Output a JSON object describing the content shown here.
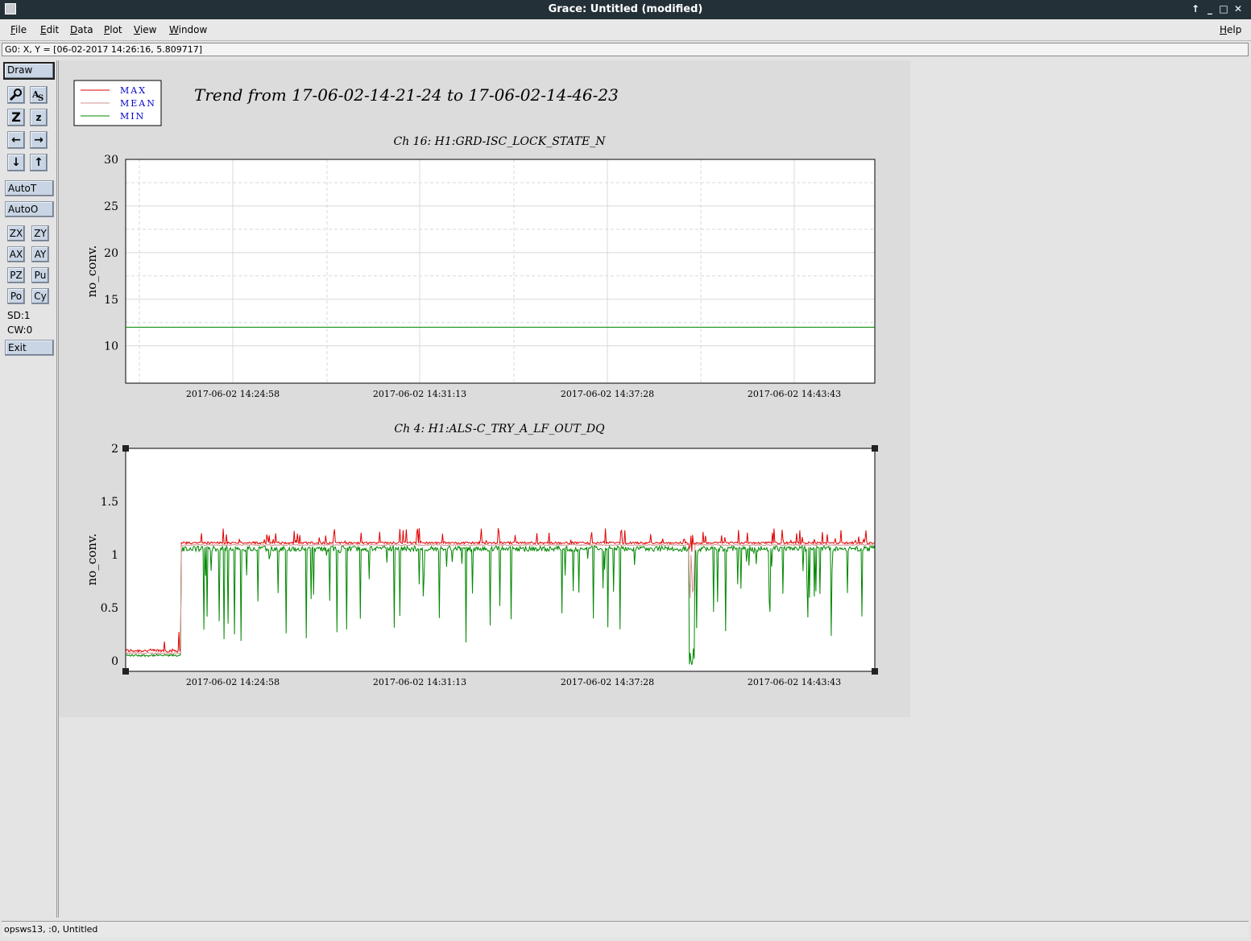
{
  "window": {
    "title": "Grace: Untitled (modified)"
  },
  "menu": [
    "File",
    "Edit",
    "Data",
    "Plot",
    "View",
    "Window"
  ],
  "menu_help": "Help",
  "locator": "G0: X, Y = [06-02-2017 14:26:16, 5.809717]",
  "toolbar": {
    "draw": "Draw",
    "autot": "AutoT",
    "autoo": "AutoO",
    "small_buttons": [
      "ZX",
      "ZY",
      "AX",
      "AY",
      "PZ",
      "Pu",
      "Po",
      "Cy"
    ],
    "sd": "SD:1",
    "cw": "CW:0",
    "exit": "Exit"
  },
  "status": "opsws13, :0, Untitled",
  "legend": [
    "MAX",
    "MEAN",
    "MIN"
  ],
  "colors": {
    "max": "#e00000",
    "mean": "#d09090",
    "min": "#008800",
    "legend_text": "#0000cc"
  },
  "chart_data": [
    {
      "type": "line",
      "title": "Trend from 17-06-02-14-21-24 to 17-06-02-14-46-23",
      "subtitle": "Ch 16: H1:GRD-ISC_LOCK_STATE_N",
      "xlabel": "",
      "ylabel": "no_conv.",
      "x_ticks": [
        "2017-06-02 14:24:58",
        "2017-06-02 14:31:13",
        "2017-06-02 14:37:28",
        "2017-06-02 14:43:43"
      ],
      "y_ticks": [
        "10",
        "15",
        "20",
        "25",
        "30"
      ],
      "ylim": [
        6,
        30
      ],
      "grid": true,
      "series": [
        {
          "name": "MAX",
          "values": [
            12,
            12
          ]
        },
        {
          "name": "MEAN",
          "values": [
            12,
            12
          ]
        },
        {
          "name": "MIN",
          "values": [
            12,
            12
          ]
        }
      ]
    },
    {
      "type": "line",
      "subtitle": "Ch 4: H1:ALS-C_TRY_A_LF_OUT_DQ",
      "xlabel": "",
      "ylabel": "no_conv.",
      "x_ticks": [
        "2017-06-02 14:24:58",
        "2017-06-02 14:31:13",
        "2017-06-02 14:37:28",
        "2017-06-02 14:43:43"
      ],
      "y_ticks": [
        "0",
        "0.5",
        "1",
        "1.5",
        "2"
      ],
      "ylim": [
        -0.1,
        2
      ],
      "grid": true,
      "series": [
        {
          "name": "MAX",
          "baseline_before_step": 0.08,
          "baseline_after_step": 1.1,
          "spike_max": 1.25
        },
        {
          "name": "MEAN",
          "baseline_before_step": 0.07,
          "baseline_after_step": 1.09
        },
        {
          "name": "MIN",
          "baseline_before_step": 0.05,
          "baseline_after_step": 1.08,
          "dip_min": -0.05
        }
      ]
    }
  ]
}
